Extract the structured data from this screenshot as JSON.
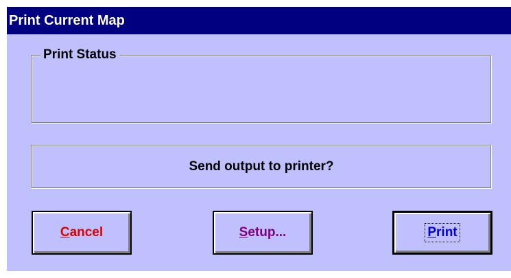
{
  "window": {
    "title": "Print Current Map"
  },
  "status_group": {
    "legend": "Print Status",
    "content": ""
  },
  "prompt": {
    "text": "Send output to printer?"
  },
  "buttons": {
    "cancel": {
      "accel": "C",
      "rest": "ancel"
    },
    "setup": {
      "accel": "S",
      "rest": "etup..."
    },
    "print": {
      "accel": "P",
      "rest": "rint",
      "is_default": true
    }
  },
  "colors": {
    "titlebar_bg": "#000080",
    "titlebar_text": "#ffffff",
    "dialog_bg": "#c0c0ff",
    "cancel_text": "#e00000",
    "setup_text": "#800080",
    "print_text": "#0000e0"
  }
}
